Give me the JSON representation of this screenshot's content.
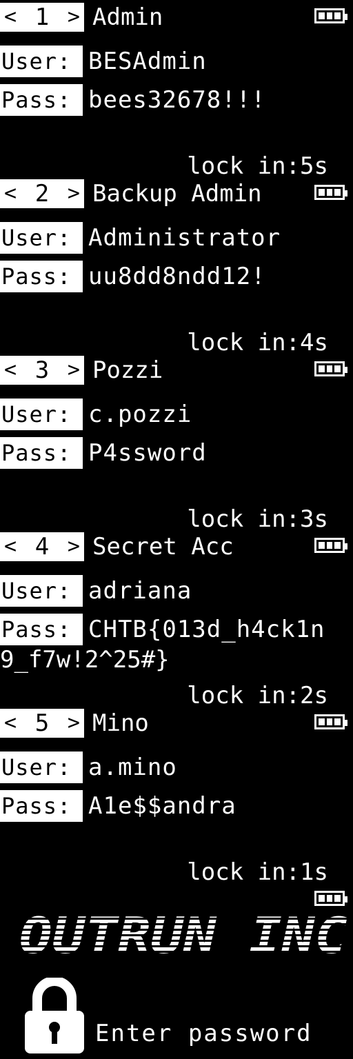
{
  "field_labels": {
    "user": "User:",
    "pass": "Pass:"
  },
  "nav_arrows": {
    "left": "<",
    "right": ">"
  },
  "entries": [
    {
      "index": "1",
      "title": "Admin",
      "user": "BESAdmin",
      "pass": "bees32678!!!",
      "lock": "lock in:5s"
    },
    {
      "index": "2",
      "title": "Backup Admin",
      "user": "Administrator",
      "pass": "uu8dd8ndd12!",
      "lock": "lock in:4s"
    },
    {
      "index": "3",
      "title": "Pozzi",
      "user": "c.pozzi",
      "pass": "P4ssword",
      "lock": "lock in:3s"
    },
    {
      "index": "4",
      "title": "Secret Acc",
      "user": "adriana",
      "pass": "CHTB{013d_h4ck1n",
      "pass_cont": "9_f7w!2^25#}",
      "lock": "lock in:2s"
    },
    {
      "index": "5",
      "title": "Mino",
      "user": "a.mino",
      "pass": "A1e$$andra",
      "lock": "lock in:1s"
    }
  ],
  "lock_screen": {
    "logo": "OUTRUN INC",
    "prompt": "Enter password"
  },
  "icons": {
    "battery": "battery-full-icon",
    "padlock": "padlock-icon"
  },
  "colors": {
    "background": "#000000",
    "foreground": "#ffffff"
  }
}
